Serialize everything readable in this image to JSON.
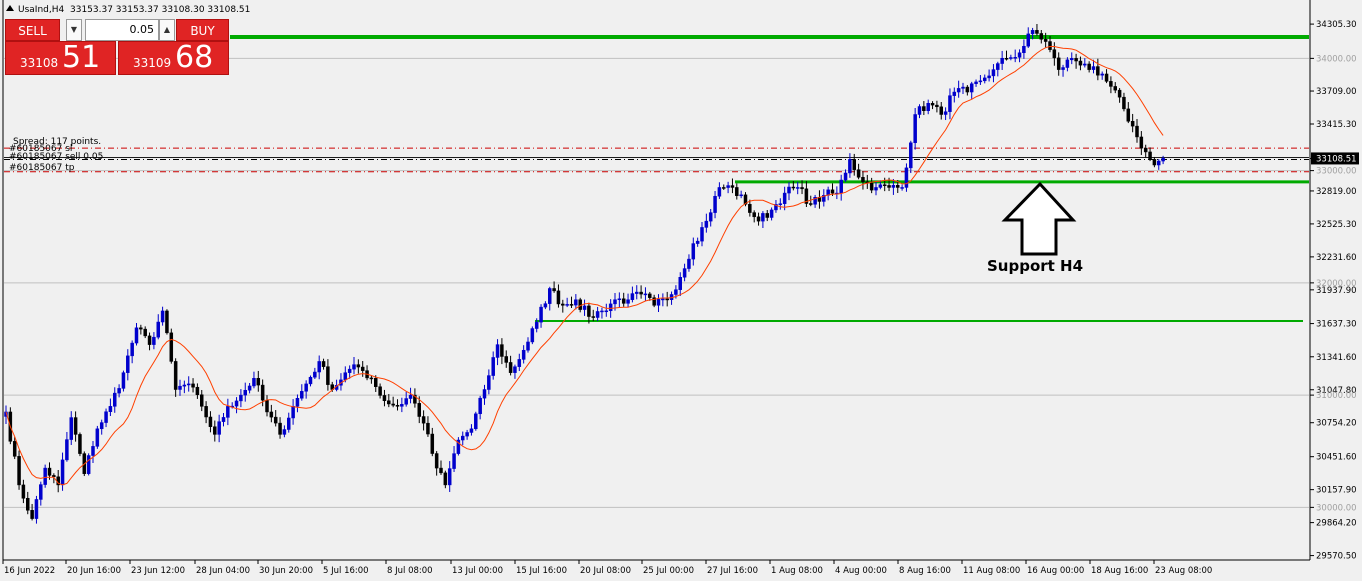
{
  "header": {
    "symbol": "UsaInd,H4",
    "ohlc": "33153.37 33153.37 33108.30 33108.51"
  },
  "trade_panel": {
    "sell_label": "SELL",
    "buy_label": "BUY",
    "volume": "0.05",
    "sell_small": "33108",
    "sell_big": "51",
    "buy_small": "33109",
    "buy_big": "68"
  },
  "order_info": {
    "spread": "Spread: 117 points.",
    "sl_label": "#60185067 sl",
    "sell_label": "#60185067 sell 0.05",
    "tp_label": "#60185067 tp"
  },
  "annotation": {
    "text": "Support H4"
  },
  "colors": {
    "bull": "#0000cc",
    "bear": "#000000",
    "ma": "#ff4000",
    "support": "#00aa00",
    "background": "#f0f0f0",
    "grid": "#c0c0c0",
    "order_line": "#cc0000",
    "current_price": "#000000"
  },
  "chart_data": {
    "type": "candlestick",
    "timeframe": "H4",
    "y_tick_labels": [
      "34305.30",
      "34000.00",
      "33709.00",
      "33415.30",
      "33108.51",
      "33000.00",
      "32819.00",
      "32525.30",
      "32231.60",
      "32000.00",
      "31937.90",
      "31637.30",
      "31341.60",
      "31047.80",
      "31000.00",
      "30754.20",
      "30451.60",
      "30157.90",
      "30000.00",
      "29864.20",
      "29570.50"
    ],
    "x_tick_labels": [
      "16 Jun 2022",
      "20 Jun 16:00",
      "23 Jun 12:00",
      "28 Jun 04:00",
      "30 Jun 20:00",
      "5 Jul 16:00",
      "8 Jul 08:00",
      "13 Jul 00:00",
      "15 Jul 16:00",
      "20 Jul 08:00",
      "25 Jul 00:00",
      "27 Jul 16:00",
      "1 Aug 08:00",
      "4 Aug 00:00",
      "8 Aug 16:00",
      "11 Aug 08:00",
      "16 Aug 00:00",
      "18 Aug 16:00",
      "23 Aug 08:00"
    ],
    "ylim": [
      29540,
      34520
    ],
    "current_price": 33108.51,
    "round_levels": [
      34000,
      33000,
      32000,
      31000,
      30000
    ],
    "support_levels": [
      34190,
      32900,
      31660
    ],
    "order_levels": {
      "sl": 33200,
      "sell": 33108.51,
      "tp": 32990
    },
    "ma_period_note": "",
    "anchors": [
      [
        0,
        30850
      ],
      [
        3,
        30200
      ],
      [
        6,
        29900
      ],
      [
        9,
        30350
      ],
      [
        12,
        30200
      ],
      [
        15,
        30800
      ],
      [
        18,
        30300
      ],
      [
        21,
        30700
      ],
      [
        24,
        30900
      ],
      [
        27,
        31200
      ],
      [
        30,
        31600
      ],
      [
        33,
        31450
      ],
      [
        36,
        31750
      ],
      [
        39,
        31050
      ],
      [
        42,
        31100
      ],
      [
        45,
        30900
      ],
      [
        48,
        30650
      ],
      [
        51,
        30900
      ],
      [
        54,
        31000
      ],
      [
        57,
        31150
      ],
      [
        60,
        30850
      ],
      [
        63,
        30650
      ],
      [
        66,
        30900
      ],
      [
        69,
        31100
      ],
      [
        72,
        31300
      ],
      [
        75,
        31050
      ],
      [
        78,
        31200
      ],
      [
        81,
        31250
      ],
      [
        84,
        31150
      ],
      [
        87,
        30950
      ],
      [
        90,
        30900
      ],
      [
        93,
        31000
      ],
      [
        96,
        30750
      ],
      [
        99,
        30350
      ],
      [
        101,
        30200
      ],
      [
        104,
        30600
      ],
      [
        107,
        30700
      ],
      [
        110,
        31050
      ],
      [
        113,
        31450
      ],
      [
        116,
        31200
      ],
      [
        119,
        31400
      ],
      [
        122,
        31650
      ],
      [
        125,
        31950
      ],
      [
        128,
        31800
      ],
      [
        131,
        31850
      ],
      [
        134,
        31700
      ],
      [
        137,
        31750
      ],
      [
        140,
        31850
      ],
      [
        143,
        31850
      ],
      [
        146,
        31900
      ],
      [
        149,
        31800
      ],
      [
        152,
        31850
      ],
      [
        155,
        32050
      ],
      [
        158,
        32350
      ],
      [
        161,
        32550
      ],
      [
        164,
        32850
      ],
      [
        167,
        32850
      ],
      [
        170,
        32700
      ],
      [
        173,
        32550
      ],
      [
        176,
        32650
      ],
      [
        179,
        32800
      ],
      [
        182,
        32850
      ],
      [
        185,
        32700
      ],
      [
        188,
        32780
      ],
      [
        191,
        32800
      ],
      [
        194,
        33100
      ],
      [
        197,
        32900
      ],
      [
        200,
        32850
      ],
      [
        203,
        32850
      ],
      [
        206,
        32850
      ],
      [
        209,
        33500
      ],
      [
        212,
        33600
      ],
      [
        215,
        33500
      ],
      [
        218,
        33700
      ],
      [
        221,
        33700
      ],
      [
        224,
        33800
      ],
      [
        227,
        33900
      ],
      [
        230,
        34000
      ],
      [
        233,
        34050
      ],
      [
        236,
        34250
      ],
      [
        239,
        34150
      ],
      [
        242,
        33900
      ],
      [
        245,
        34000
      ],
      [
        248,
        33950
      ],
      [
        251,
        33850
      ],
      [
        254,
        33750
      ],
      [
        257,
        33550
      ],
      [
        260,
        33300
      ],
      [
        263,
        33100
      ],
      [
        264,
        33050
      ],
      [
        266,
        33110
      ]
    ]
  }
}
